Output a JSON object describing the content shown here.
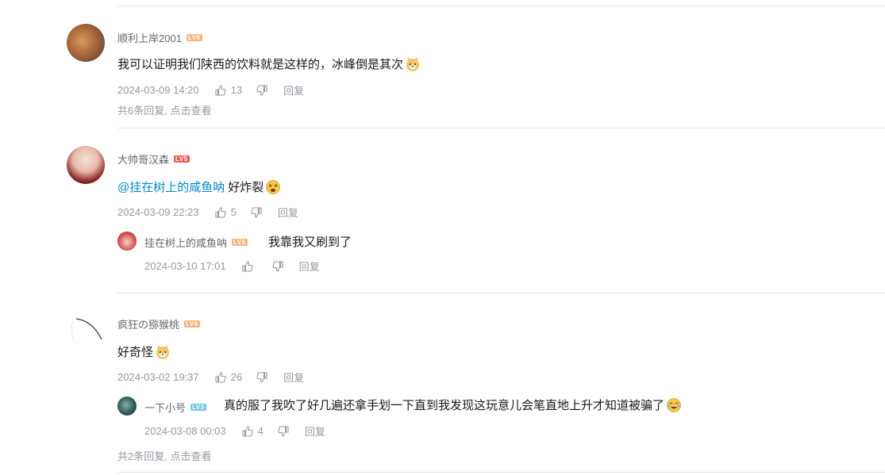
{
  "comments": [
    {
      "username": "顺利上岸2001",
      "level": "LV6",
      "content": "我可以证明我们陕西的饮料就是这样的，冰峰倒是其次",
      "emoji": "doge-icon",
      "time": "2024-03-09 14:20",
      "likes": "13",
      "reply_label": "回复",
      "more_replies": "共6条回复, 点击查看"
    },
    {
      "username": "大帅哥汉森",
      "level": "LV5",
      "mention": "@挂在树上的咸鱼呐",
      "content": "好炸裂",
      "emoji": "dizzy-icon",
      "time": "2024-03-09 22:23",
      "likes": "5",
      "reply_label": "回复",
      "reply": {
        "username": "挂在树上的咸鱼呐",
        "level": "LV6",
        "content": "我靠我又刷到了",
        "time": "2024-03-10 17:01",
        "reply_label": "回复"
      }
    },
    {
      "username": "疯狂の猕猴桃",
      "level": "LV6",
      "content": "好奇怪",
      "emoji": "doge-icon",
      "time": "2024-03-02 19:37",
      "likes": "26",
      "reply_label": "回复",
      "reply": {
        "username": "一下小号",
        "level": "LV3",
        "content": "真的服了我吹了好几遍还拿手划一下直到我发现这玩意儿会笔直地上升才知道被骗了",
        "emoji": "laugh-cry-icon",
        "time": "2024-03-08 00:03",
        "likes": "4",
        "reply_label": "回复"
      },
      "more_replies": "共2条回复, 点击查看"
    }
  ]
}
